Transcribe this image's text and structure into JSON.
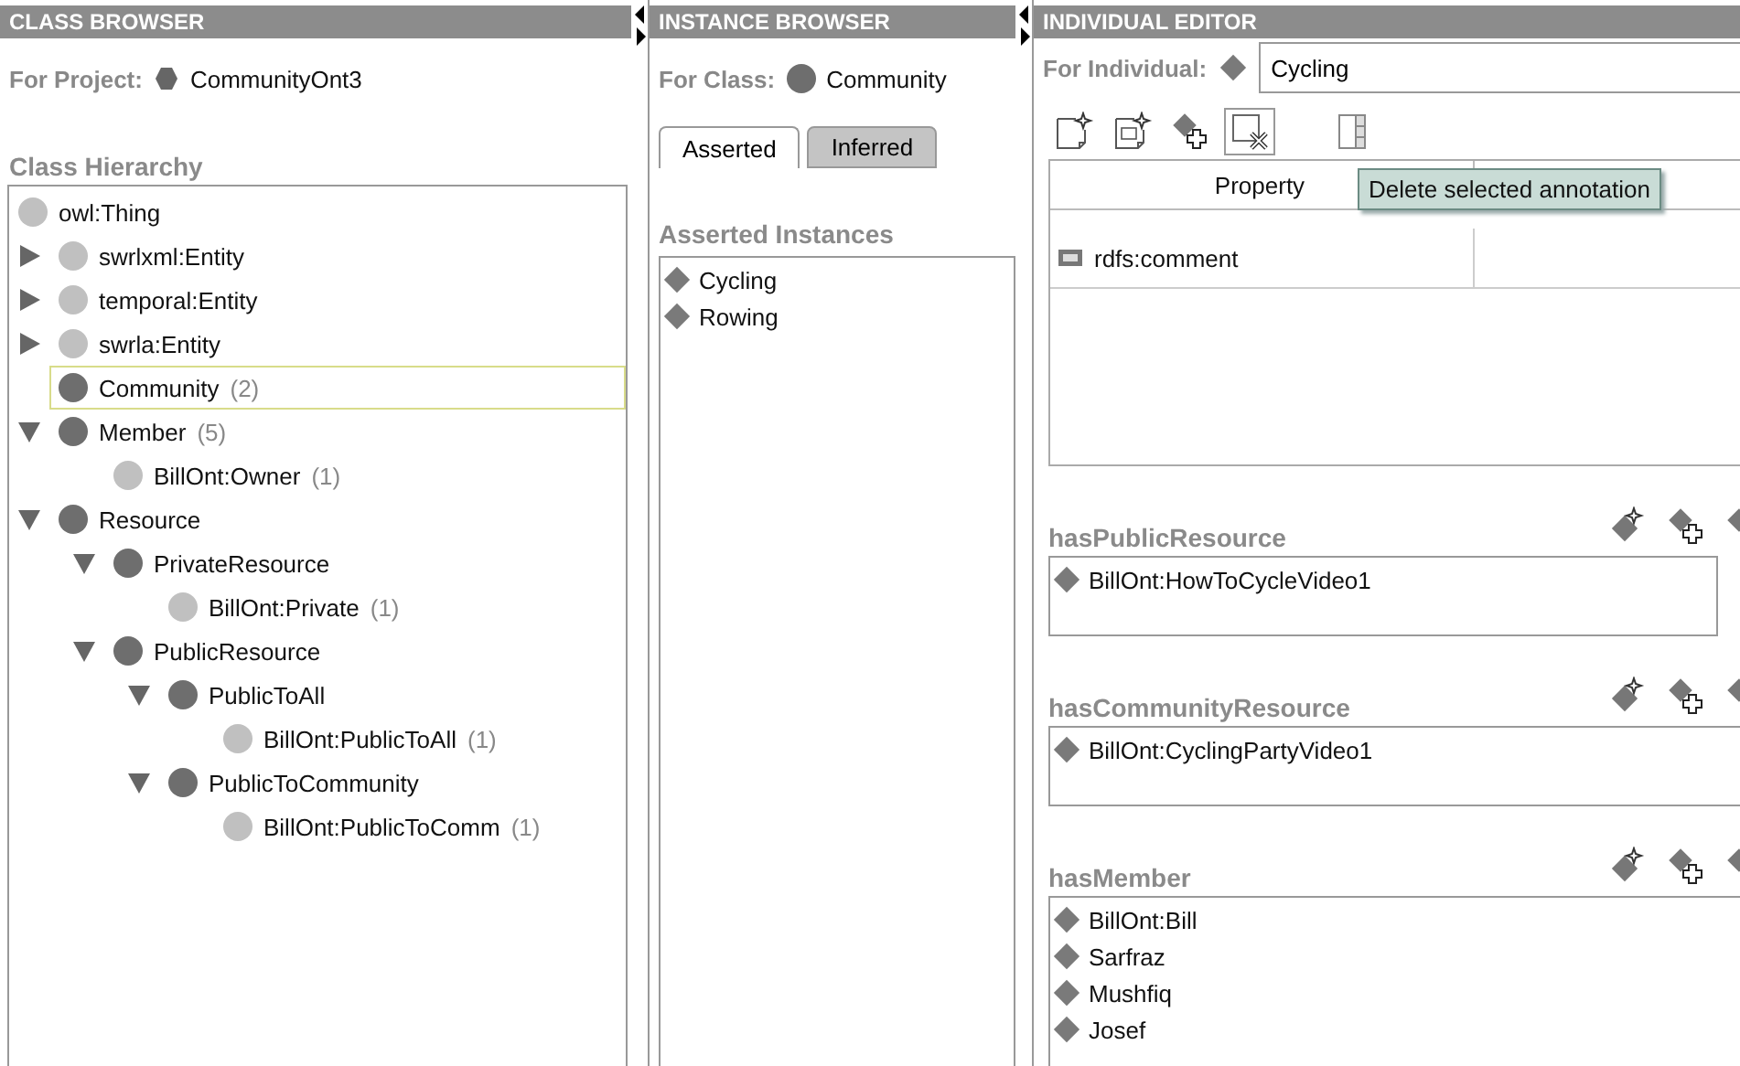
{
  "class_browser": {
    "title": "CLASS BROWSER",
    "project_label": "For Project:",
    "project": "CommunityOnt3",
    "hierarchy_title": "Class Hierarchy",
    "tree": [
      {
        "label": "owl:Thing",
        "kind": "imported",
        "selected": false,
        "children": [
          {
            "label": "swrlxml:Entity",
            "kind": "imported",
            "selected": false,
            "expanded": false
          },
          {
            "label": "temporal:Entity",
            "kind": "imported",
            "selected": false,
            "expanded": false
          },
          {
            "label": "swrla:Entity",
            "kind": "imported",
            "selected": false,
            "expanded": false
          },
          {
            "label": "Community",
            "count": "(2)",
            "kind": "local",
            "selected": true
          },
          {
            "label": "Member",
            "count": "(5)",
            "kind": "local",
            "selected": false,
            "expanded": true,
            "children": [
              {
                "label": "BillOnt:Owner",
                "count": "(1)",
                "kind": "imported",
                "selected": false
              }
            ]
          },
          {
            "label": "Resource",
            "kind": "local",
            "selected": false,
            "expanded": true,
            "children": [
              {
                "label": "PrivateResource",
                "kind": "local",
                "selected": false,
                "expanded": true,
                "children": [
                  {
                    "label": "BillOnt:Private",
                    "count": "(1)",
                    "kind": "imported",
                    "selected": false
                  }
                ]
              },
              {
                "label": "PublicResource",
                "kind": "local",
                "selected": false,
                "expanded": true,
                "children": [
                  {
                    "label": "PublicToAll",
                    "kind": "local",
                    "selected": false,
                    "expanded": true,
                    "children": [
                      {
                        "label": "BillOnt:PublicToAll",
                        "count": "(1)",
                        "kind": "imported",
                        "selected": false
                      }
                    ]
                  },
                  {
                    "label": "PublicToCommunity",
                    "kind": "local",
                    "selected": false,
                    "expanded": true,
                    "children": [
                      {
                        "label": "BillOnt:PublicToComm",
                        "count": "(1)",
                        "kind": "imported",
                        "selected": false
                      }
                    ]
                  }
                ]
              }
            ]
          }
        ]
      }
    ]
  },
  "instance_browser": {
    "title": "INSTANCE BROWSER",
    "class_label": "For Class:",
    "class": "Community",
    "tabs": [
      {
        "label": "Asserted",
        "selected": true
      },
      {
        "label": "Inferred",
        "selected": false
      }
    ],
    "list_title": "Asserted Instances",
    "instances": [
      "Cycling",
      "Rowing"
    ]
  },
  "individual_editor": {
    "title": "INDIVIDUAL EDITOR",
    "individual_label": "For Individual:",
    "individual": "Cycling",
    "toolbar": [
      {
        "kind": "new-annotation",
        "pressed": false
      },
      {
        "kind": "new-document",
        "pressed": false
      },
      {
        "kind": "add-value",
        "pressed": false
      },
      {
        "kind": "delete",
        "pressed": true
      },
      {
        "kind": "panel",
        "pressed": false
      }
    ],
    "tooltip": "Delete selected annotation",
    "table": {
      "columns": [
        "Property"
      ],
      "rows": [
        "rdfs:comment"
      ]
    },
    "properties": [
      {
        "name": "hasPublicResource",
        "values": [
          "BillOnt:HowToCycleVideo1"
        ]
      },
      {
        "name": "hasCommunityResource",
        "values": [
          "BillOnt:CyclingPartyVideo1"
        ]
      },
      {
        "name": "hasMember",
        "values": [
          "BillOnt:Bill",
          "Sarfraz",
          "Mushfiq",
          "Josef"
        ]
      }
    ]
  }
}
